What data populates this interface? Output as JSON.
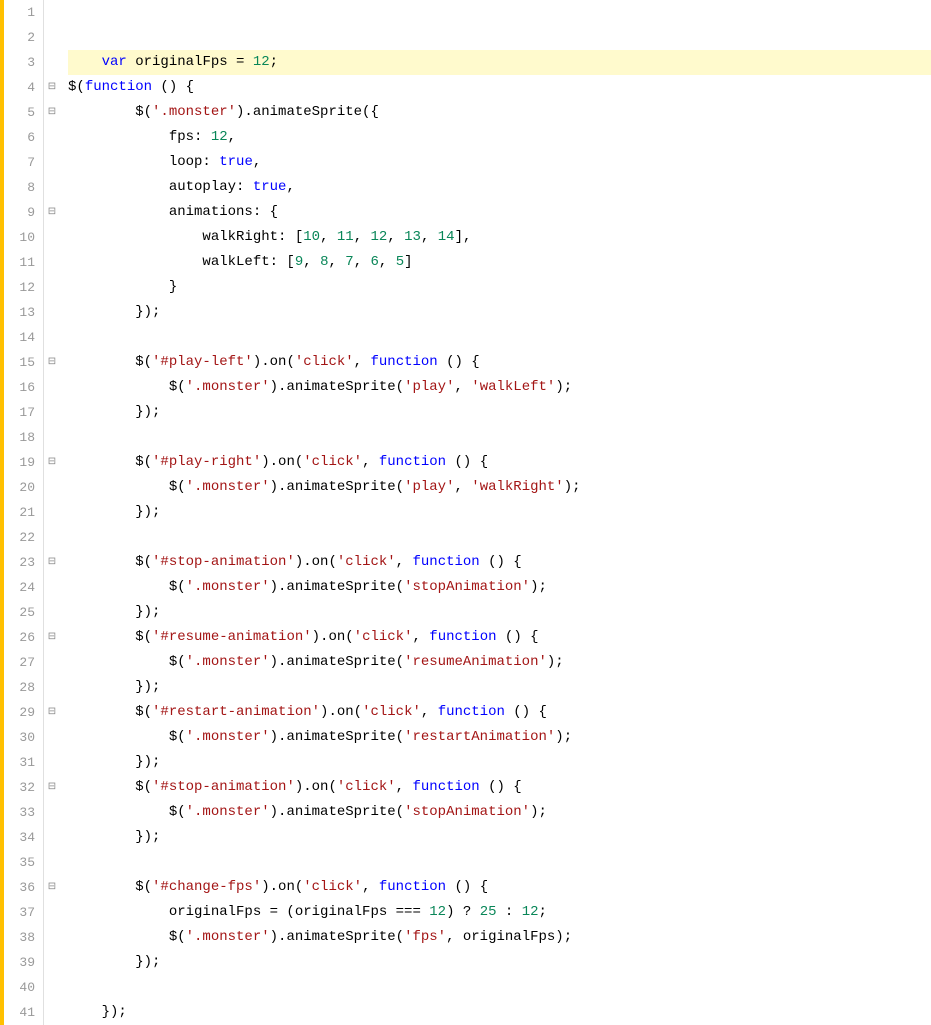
{
  "editor": {
    "lines": [
      {
        "num": 1,
        "fold": "",
        "indent": 0,
        "content": []
      },
      {
        "num": 2,
        "fold": "",
        "indent": 0,
        "content": []
      },
      {
        "num": 3,
        "fold": "",
        "indent": 0,
        "highlight": true,
        "content": [
          {
            "type": "indent",
            "text": "    "
          },
          {
            "type": "kw",
            "text": "var"
          },
          {
            "type": "plain",
            "text": " originalFps = "
          },
          {
            "type": "num",
            "text": "12"
          },
          {
            "type": "plain",
            "text": ";"
          }
        ]
      },
      {
        "num": 4,
        "fold": "⊟",
        "indent": 0,
        "content": [
          {
            "type": "plain",
            "text": "$("
          },
          {
            "type": "kw",
            "text": "function"
          },
          {
            "type": "plain",
            "text": " () {"
          }
        ]
      },
      {
        "num": 5,
        "fold": "⊟",
        "indent": 1,
        "content": [
          {
            "type": "plain",
            "text": "        $("
          },
          {
            "type": "str",
            "text": "'.monster'"
          },
          {
            "type": "plain",
            "text": ").animateSprite({"
          }
        ]
      },
      {
        "num": 6,
        "fold": "",
        "indent": 2,
        "content": [
          {
            "type": "plain",
            "text": "            fps: "
          },
          {
            "type": "num",
            "text": "12"
          },
          {
            "type": "plain",
            "text": ","
          }
        ]
      },
      {
        "num": 7,
        "fold": "",
        "indent": 2,
        "content": [
          {
            "type": "plain",
            "text": "            loop: "
          },
          {
            "type": "kw",
            "text": "true"
          },
          {
            "type": "plain",
            "text": ","
          }
        ]
      },
      {
        "num": 8,
        "fold": "",
        "indent": 2,
        "content": [
          {
            "type": "plain",
            "text": "            autoplay: "
          },
          {
            "type": "kw",
            "text": "true"
          },
          {
            "type": "plain",
            "text": ","
          }
        ]
      },
      {
        "num": 9,
        "fold": "⊟",
        "indent": 2,
        "content": [
          {
            "type": "plain",
            "text": "            animations: {"
          }
        ]
      },
      {
        "num": 10,
        "fold": "",
        "indent": 3,
        "content": [
          {
            "type": "plain",
            "text": "                walkRight: ["
          },
          {
            "type": "num",
            "text": "10"
          },
          {
            "type": "plain",
            "text": ", "
          },
          {
            "type": "num",
            "text": "11"
          },
          {
            "type": "plain",
            "text": ", "
          },
          {
            "type": "num",
            "text": "12"
          },
          {
            "type": "plain",
            "text": ", "
          },
          {
            "type": "num",
            "text": "13"
          },
          {
            "type": "plain",
            "text": ", "
          },
          {
            "type": "num",
            "text": "14"
          },
          {
            "type": "plain",
            "text": "],"
          }
        ]
      },
      {
        "num": 11,
        "fold": "",
        "indent": 3,
        "content": [
          {
            "type": "plain",
            "text": "                walkLeft: ["
          },
          {
            "type": "num",
            "text": "9"
          },
          {
            "type": "plain",
            "text": ", "
          },
          {
            "type": "num",
            "text": "8"
          },
          {
            "type": "plain",
            "text": ", "
          },
          {
            "type": "num",
            "text": "7"
          },
          {
            "type": "plain",
            "text": ", "
          },
          {
            "type": "num",
            "text": "6"
          },
          {
            "type": "plain",
            "text": ", "
          },
          {
            "type": "num",
            "text": "5"
          },
          {
            "type": "plain",
            "text": "]"
          }
        ]
      },
      {
        "num": 12,
        "fold": "",
        "indent": 2,
        "content": [
          {
            "type": "plain",
            "text": "            }"
          }
        ]
      },
      {
        "num": 13,
        "fold": "",
        "indent": 1,
        "content": [
          {
            "type": "plain",
            "text": "        });"
          }
        ]
      },
      {
        "num": 14,
        "fold": "",
        "indent": 0,
        "content": []
      },
      {
        "num": 15,
        "fold": "⊟",
        "indent": 1,
        "content": [
          {
            "type": "plain",
            "text": "        $("
          },
          {
            "type": "str",
            "text": "'#play-left'"
          },
          {
            "type": "plain",
            "text": ").on("
          },
          {
            "type": "str",
            "text": "'click'"
          },
          {
            "type": "plain",
            "text": ", "
          },
          {
            "type": "kw",
            "text": "function"
          },
          {
            "type": "plain",
            "text": " () {"
          }
        ]
      },
      {
        "num": 16,
        "fold": "",
        "indent": 2,
        "content": [
          {
            "type": "plain",
            "text": "            $("
          },
          {
            "type": "str",
            "text": "'.monster'"
          },
          {
            "type": "plain",
            "text": ").animateSprite("
          },
          {
            "type": "str",
            "text": "'play'"
          },
          {
            "type": "plain",
            "text": ", "
          },
          {
            "type": "str",
            "text": "'walkLeft'"
          },
          {
            "type": "plain",
            "text": ");"
          }
        ]
      },
      {
        "num": 17,
        "fold": "",
        "indent": 1,
        "content": [
          {
            "type": "plain",
            "text": "        });"
          }
        ]
      },
      {
        "num": 18,
        "fold": "",
        "indent": 0,
        "content": []
      },
      {
        "num": 19,
        "fold": "⊟",
        "indent": 1,
        "content": [
          {
            "type": "plain",
            "text": "        $("
          },
          {
            "type": "str",
            "text": "'#play-right'"
          },
          {
            "type": "plain",
            "text": ").on("
          },
          {
            "type": "str",
            "text": "'click'"
          },
          {
            "type": "plain",
            "text": ", "
          },
          {
            "type": "kw",
            "text": "function"
          },
          {
            "type": "plain",
            "text": " () {"
          }
        ]
      },
      {
        "num": 20,
        "fold": "",
        "indent": 2,
        "content": [
          {
            "type": "plain",
            "text": "            $("
          },
          {
            "type": "str",
            "text": "'.monster'"
          },
          {
            "type": "plain",
            "text": ").animateSprite("
          },
          {
            "type": "str",
            "text": "'play'"
          },
          {
            "type": "plain",
            "text": ", "
          },
          {
            "type": "str",
            "text": "'walkRight'"
          },
          {
            "type": "plain",
            "text": ");"
          }
        ]
      },
      {
        "num": 21,
        "fold": "",
        "indent": 1,
        "content": [
          {
            "type": "plain",
            "text": "        });"
          }
        ]
      },
      {
        "num": 22,
        "fold": "",
        "indent": 0,
        "content": []
      },
      {
        "num": 23,
        "fold": "⊟",
        "indent": 1,
        "content": [
          {
            "type": "plain",
            "text": "        $("
          },
          {
            "type": "str",
            "text": "'#stop-animation'"
          },
          {
            "type": "plain",
            "text": ").on("
          },
          {
            "type": "str",
            "text": "'click'"
          },
          {
            "type": "plain",
            "text": ", "
          },
          {
            "type": "kw",
            "text": "function"
          },
          {
            "type": "plain",
            "text": " () {"
          }
        ]
      },
      {
        "num": 24,
        "fold": "",
        "indent": 2,
        "content": [
          {
            "type": "plain",
            "text": "            $("
          },
          {
            "type": "str",
            "text": "'.monster'"
          },
          {
            "type": "plain",
            "text": ").animateSprite("
          },
          {
            "type": "str",
            "text": "'stopAnimation'"
          },
          {
            "type": "plain",
            "text": ");"
          }
        ]
      },
      {
        "num": 25,
        "fold": "",
        "indent": 1,
        "content": [
          {
            "type": "plain",
            "text": "        });"
          }
        ]
      },
      {
        "num": 26,
        "fold": "⊟",
        "indent": 1,
        "content": [
          {
            "type": "plain",
            "text": "        $("
          },
          {
            "type": "str",
            "text": "'#resume-animation'"
          },
          {
            "type": "plain",
            "text": ").on("
          },
          {
            "type": "str",
            "text": "'click'"
          },
          {
            "type": "plain",
            "text": ", "
          },
          {
            "type": "kw",
            "text": "function"
          },
          {
            "type": "plain",
            "text": " () {"
          }
        ]
      },
      {
        "num": 27,
        "fold": "",
        "indent": 2,
        "content": [
          {
            "type": "plain",
            "text": "            $("
          },
          {
            "type": "str",
            "text": "'.monster'"
          },
          {
            "type": "plain",
            "text": ").animateSprite("
          },
          {
            "type": "str",
            "text": "'resumeAnimation'"
          },
          {
            "type": "plain",
            "text": ");"
          }
        ]
      },
      {
        "num": 28,
        "fold": "",
        "indent": 1,
        "content": [
          {
            "type": "plain",
            "text": "        });"
          }
        ]
      },
      {
        "num": 29,
        "fold": "⊟",
        "indent": 1,
        "content": [
          {
            "type": "plain",
            "text": "        $("
          },
          {
            "type": "str",
            "text": "'#restart-animation'"
          },
          {
            "type": "plain",
            "text": ").on("
          },
          {
            "type": "str",
            "text": "'click'"
          },
          {
            "type": "plain",
            "text": ", "
          },
          {
            "type": "kw",
            "text": "function"
          },
          {
            "type": "plain",
            "text": " () {"
          }
        ]
      },
      {
        "num": 30,
        "fold": "",
        "indent": 2,
        "content": [
          {
            "type": "plain",
            "text": "            $("
          },
          {
            "type": "str",
            "text": "'.monster'"
          },
          {
            "type": "plain",
            "text": ").animateSprite("
          },
          {
            "type": "str",
            "text": "'restartAnimation'"
          },
          {
            "type": "plain",
            "text": ");"
          }
        ]
      },
      {
        "num": 31,
        "fold": "",
        "indent": 1,
        "content": [
          {
            "type": "plain",
            "text": "        });"
          }
        ]
      },
      {
        "num": 32,
        "fold": "⊟",
        "indent": 1,
        "content": [
          {
            "type": "plain",
            "text": "        $("
          },
          {
            "type": "str",
            "text": "'#stop-animation'"
          },
          {
            "type": "plain",
            "text": ").on("
          },
          {
            "type": "str",
            "text": "'click'"
          },
          {
            "type": "plain",
            "text": ", "
          },
          {
            "type": "kw",
            "text": "function"
          },
          {
            "type": "plain",
            "text": " () {"
          }
        ]
      },
      {
        "num": 33,
        "fold": "",
        "indent": 2,
        "content": [
          {
            "type": "plain",
            "text": "            $("
          },
          {
            "type": "str",
            "text": "'.monster'"
          },
          {
            "type": "plain",
            "text": ").animateSprite("
          },
          {
            "type": "str",
            "text": "'stopAnimation'"
          },
          {
            "type": "plain",
            "text": ");"
          }
        ]
      },
      {
        "num": 34,
        "fold": "",
        "indent": 1,
        "content": [
          {
            "type": "plain",
            "text": "        });"
          }
        ]
      },
      {
        "num": 35,
        "fold": "",
        "indent": 0,
        "content": []
      },
      {
        "num": 36,
        "fold": "⊟",
        "indent": 1,
        "content": [
          {
            "type": "plain",
            "text": "        $("
          },
          {
            "type": "str",
            "text": "'#change-fps'"
          },
          {
            "type": "plain",
            "text": ").on("
          },
          {
            "type": "str",
            "text": "'click'"
          },
          {
            "type": "plain",
            "text": ", "
          },
          {
            "type": "kw",
            "text": "function"
          },
          {
            "type": "plain",
            "text": " () {"
          }
        ]
      },
      {
        "num": 37,
        "fold": "",
        "indent": 2,
        "content": [
          {
            "type": "plain",
            "text": "            originalFps = (originalFps === "
          },
          {
            "type": "num",
            "text": "12"
          },
          {
            "type": "plain",
            "text": ") ? "
          },
          {
            "type": "num",
            "text": "25"
          },
          {
            "type": "plain",
            "text": " : "
          },
          {
            "type": "num",
            "text": "12"
          },
          {
            "type": "plain",
            "text": ";"
          }
        ]
      },
      {
        "num": 38,
        "fold": "",
        "indent": 2,
        "content": [
          {
            "type": "plain",
            "text": "            $("
          },
          {
            "type": "str",
            "text": "'.monster'"
          },
          {
            "type": "plain",
            "text": ").animateSprite("
          },
          {
            "type": "str",
            "text": "'fps'"
          },
          {
            "type": "plain",
            "text": ", originalFps);"
          }
        ]
      },
      {
        "num": 39,
        "fold": "",
        "indent": 1,
        "content": [
          {
            "type": "plain",
            "text": "        });"
          }
        ]
      },
      {
        "num": 40,
        "fold": "",
        "indent": 0,
        "content": []
      },
      {
        "num": 41,
        "fold": "",
        "indent": 0,
        "content": [
          {
            "type": "plain",
            "text": "    });"
          }
        ]
      }
    ]
  }
}
